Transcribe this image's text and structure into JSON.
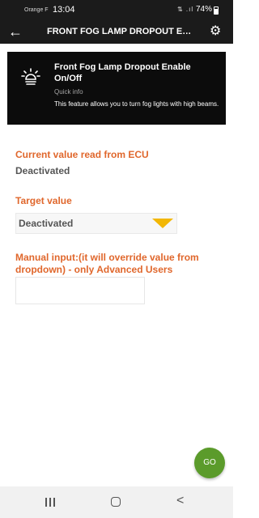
{
  "status_bar": {
    "carrier": "Orange F",
    "time": "13:04",
    "icons": "⇅ .ıl",
    "battery": "74%"
  },
  "app_bar": {
    "title": "FRONT FOG LAMP DROPOUT ENABLE ON/OFF",
    "back_icon": "←",
    "settings_icon": "⚙"
  },
  "info_card": {
    "title": "Front Fog Lamp Dropout Enable On/Off",
    "subtitle": "Quick info",
    "description": "This feature allows you to turn fog lights with high beams."
  },
  "current": {
    "label": "Current value read from ECU",
    "value": "Deactivated"
  },
  "target": {
    "label": "Target value",
    "selected": "Deactivated"
  },
  "manual": {
    "label": "Manual input:(it will override value from dropdown) - only Advanced Users",
    "value": ""
  },
  "go_button": "GO",
  "nav": {
    "back_icon": "<"
  },
  "colors": {
    "accent_orange": "#e0672c",
    "go_green": "#5b9b2b",
    "dropdown_arrow": "#f2b705"
  }
}
